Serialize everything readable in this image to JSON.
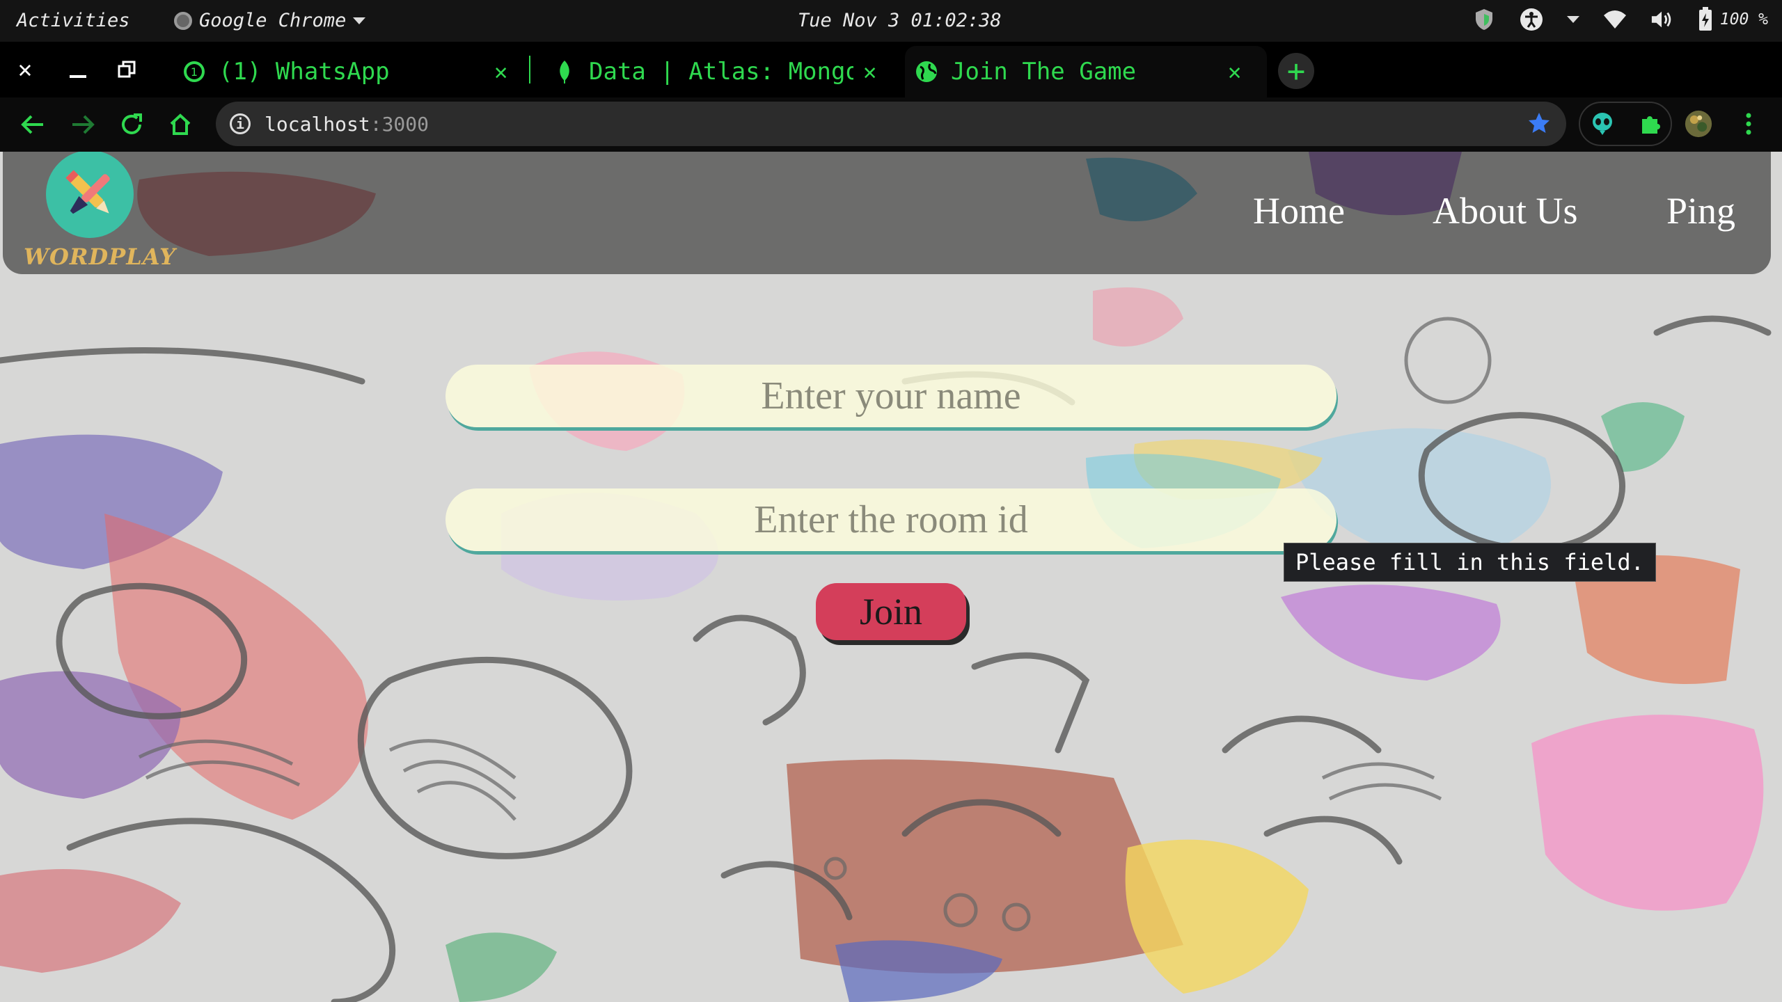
{
  "system_bar": {
    "activities": "Activities",
    "app_name": "Google Chrome",
    "clock": "Tue Nov 3 01:02:38",
    "battery": "100 %",
    "icons": [
      "shield-icon",
      "accessibility-icon",
      "wifi-icon",
      "volume-icon",
      "battery-charging-icon"
    ]
  },
  "tabs": [
    {
      "title": "(1) WhatsApp",
      "favicon": "whatsapp-icon",
      "badge": "1",
      "active": false
    },
    {
      "title": "Data | Atlas: MongoDB",
      "favicon": "mongodb-leaf-icon",
      "active": false
    },
    {
      "title": "Join The Game",
      "favicon": "globe-icon",
      "active": true
    }
  ],
  "omnibox": {
    "host": "localhost",
    "port": ":3000"
  },
  "site": {
    "brand": "WORDPLAY",
    "nav": [
      "Home",
      "About Us",
      "Ping"
    ],
    "name_input": {
      "placeholder": "Enter your name",
      "value": ""
    },
    "room_input": {
      "placeholder": "Enter the room id",
      "value": ""
    },
    "join_label": "Join",
    "validation_tooltip": "Please fill in this field."
  },
  "colors": {
    "accent_green": "#2fd94f",
    "join_button": "#d43e5a",
    "logo_teal": "#3cc0a5",
    "brand_gold": "#e0b55c"
  }
}
